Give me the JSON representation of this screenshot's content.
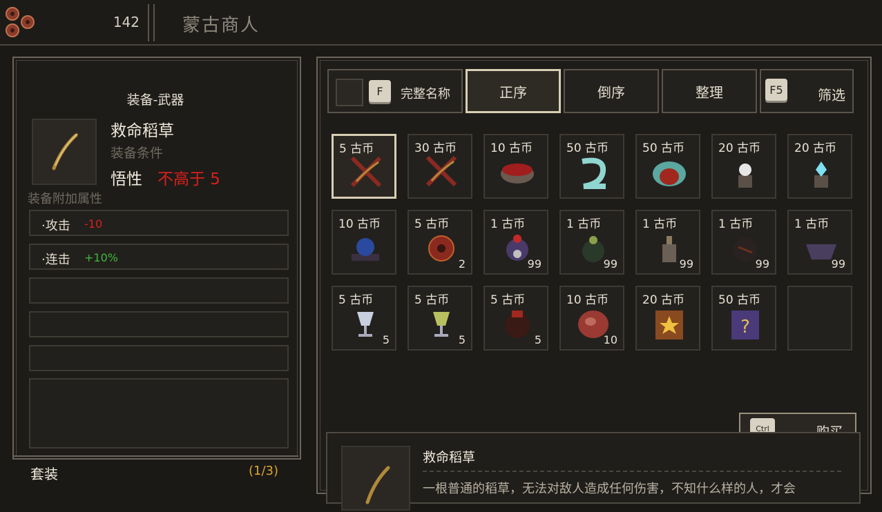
{
  "header": {
    "coin_icon": "copper-coins-icon",
    "money": "142",
    "merchant_name": "蒙古商人"
  },
  "equipment": {
    "type": "装备-武器",
    "icon": "straw-icon",
    "name": "救命稻草",
    "requirement_label": "装备条件",
    "stat_name": "悟性",
    "requirement_value": "不高于 5",
    "attributes_title": "装备附加属性",
    "attributes": [
      {
        "label": "·攻击",
        "value": "-10",
        "color": "#d8201c"
      },
      {
        "label": "·连击",
        "value": "+10%",
        "color": "#3fb83a"
      }
    ],
    "set_label": "套装",
    "set_count": "(1/3)"
  },
  "tabs": {
    "fullname_key": "F",
    "fullname": "完整名称",
    "ascending": "正序",
    "descending": "倒序",
    "sort": "整理",
    "filter_key": "F5",
    "filter": "筛选"
  },
  "shop_items": [
    {
      "price": "5 古币",
      "qty": "",
      "icon": "straw-icon",
      "selected": true
    },
    {
      "price": "30 古币",
      "qty": "",
      "icon": "straw-icon",
      "selected": false
    },
    {
      "price": "10 古币",
      "qty": "",
      "icon": "red-bowl-icon",
      "selected": false
    },
    {
      "price": "50 古币",
      "qty": "",
      "icon": "cyan-serpent-icon",
      "selected": false
    },
    {
      "price": "50 古币",
      "qty": "",
      "icon": "crab-armor-icon",
      "selected": false
    },
    {
      "price": "20 古币",
      "qty": "",
      "icon": "white-orb-pedestal-icon",
      "selected": false
    },
    {
      "price": "20 古币",
      "qty": "",
      "icon": "cyan-gem-pedestal-icon",
      "selected": false
    },
    {
      "price": "10 古币",
      "qty": "",
      "icon": "blue-crystal-icon",
      "selected": false
    },
    {
      "price": "5 古币",
      "qty": "2",
      "icon": "red-gourd-icon",
      "selected": false
    },
    {
      "price": "1 古币",
      "qty": "99",
      "icon": "purple-flower-icon",
      "selected": false
    },
    {
      "price": "1 古币",
      "qty": "99",
      "icon": "green-herb-icon",
      "selected": false
    },
    {
      "price": "1 古币",
      "qty": "99",
      "icon": "potion-bottle-icon",
      "selected": false
    },
    {
      "price": "1 古币",
      "qty": "99",
      "icon": "dark-ball-icon",
      "selected": false
    },
    {
      "price": "1 古币",
      "qty": "99",
      "icon": "purple-bowl-icon",
      "selected": false
    },
    {
      "price": "5 古币",
      "qty": "5",
      "icon": "white-goblet-icon",
      "selected": false
    },
    {
      "price": "5 古币",
      "qty": "5",
      "icon": "green-goblet-icon",
      "selected": false
    },
    {
      "price": "5 古币",
      "qty": "5",
      "icon": "wine-jar-icon",
      "selected": false
    },
    {
      "price": "10 古币",
      "qty": "10",
      "icon": "meat-icon",
      "selected": false
    },
    {
      "price": "20 古币",
      "qty": "",
      "icon": "star-book-icon",
      "selected": false
    },
    {
      "price": "50 古币",
      "qty": "",
      "icon": "mystery-book-icon",
      "selected": false
    },
    {
      "price": "",
      "qty": "",
      "icon": "",
      "selected": false
    }
  ],
  "buy": {
    "key": "Ctrl",
    "label": "购买"
  },
  "description": {
    "name": "救命稻草",
    "text": "一根普通的稻草，无法对敌人造成任何伤害，不知什么样的人，才会"
  }
}
